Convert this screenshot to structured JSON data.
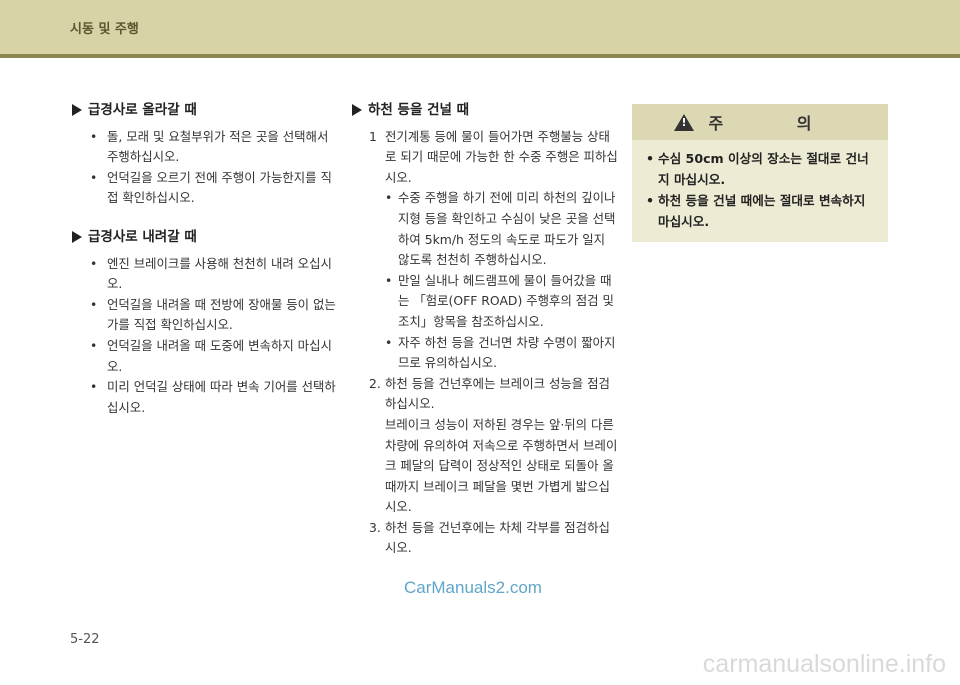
{
  "header": {
    "title": "시동 및 주행"
  },
  "left": {
    "sections": [
      {
        "title": "급경사로 올라갈 때",
        "items": [
          "돌, 모래 및 요철부위가 적은 곳을 선택해서 주행하십시오.",
          "언덕길을 오르기 전에 주행이 가능한지를 직접 확인하십시오."
        ]
      },
      {
        "title": "급경사로 내려갈 때",
        "items": [
          "엔진 브레이크를 사용해 천천히 내려 오십시오.",
          "언덕길을 내려올 때 전방에 장애물 등이 없는가를 직접 확인하십시오.",
          "언덕길을 내려올 때 도중에 변속하지 마십시오.",
          "미리 언덕길 상태에 따라 변속 기어를 선택하십시오."
        ]
      }
    ]
  },
  "middle": {
    "title": "하천 등을 건널 때",
    "steps": [
      {
        "label": "1",
        "text": "전기계통 등에 물이 들어가면 주행불능 상태로 되기 때문에 가능한 한 수중 주행은 피하십시오.",
        "sub": [
          "수중 주행을 하기 전에 미리 하천의 깊이나 지형 등을 확인하고 수심이 낮은 곳을 선택하여 5km/h 정도의 속도로 파도가 일지 않도록 천천히 주행하십시오.",
          "만일 실내나 헤드램프에 물이 들어갔을 때는 「험로(OFF ROAD) 주행후의 점검 및 조치」항목을 참조하십시오.",
          "자주 하천 등을 건너면 차량 수명이 짧아지므로 유의하십시오."
        ]
      },
      {
        "label": "2.",
        "text": "하천 등을 건넌후에는 브레이크 성능을 점검하십시오.",
        "extra": "브레이크 성능이 저하된 경우는 앞·뒤의 다른 차량에 유의하여 저속으로 주행하면서 브레이크 페달의 답력이 정상적인 상태로 되돌아 올때까지 브레이크 페달을 몇번 가볍게 밟으십시오."
      },
      {
        "label": "3.",
        "text": "하천 등을 건넌후에는 차체 각부를 점검하십시오."
      }
    ]
  },
  "caution": {
    "title": "주 의",
    "items": [
      "수심 50cm 이상의 장소는 절대로 건너지 마십시오.",
      "하천 등을 건널 때에는 절대로 변속하지 마십시오."
    ]
  },
  "watermark": "CarManuals2.com",
  "page_number": "5-22",
  "footer_watermark": "carmanualsonline.info"
}
